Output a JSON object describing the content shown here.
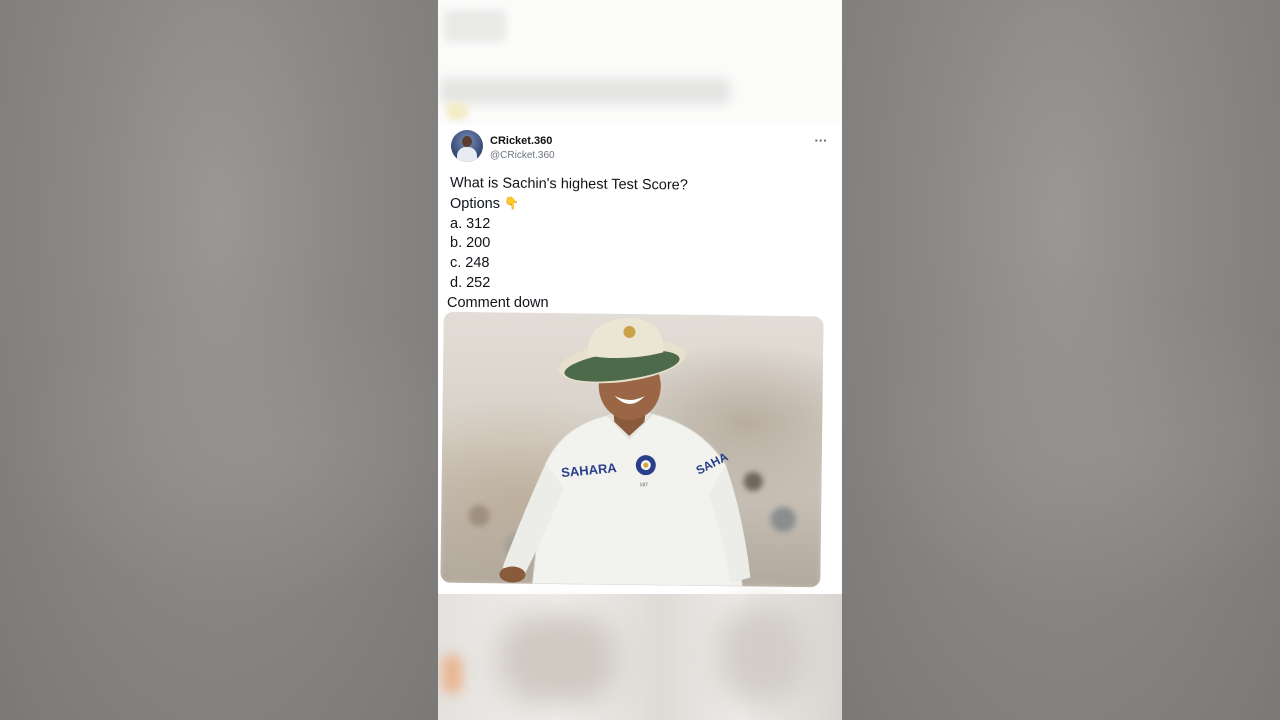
{
  "tweet": {
    "display_name": "CRicket.360",
    "handle": "@CRicket.360",
    "more_icon": "more-options-icon",
    "more_glyph": "···",
    "lines": {
      "question": "What is Sachin's highest Test Score?",
      "options_label": "Options",
      "option_a": "a. 312",
      "option_b": "b. 200",
      "option_c": "c. 248",
      "option_d": "d. 252",
      "cta": "Comment down"
    },
    "emoji_icon": "pointing-down-hand-icon",
    "emoji_glyph": "👇",
    "photo": {
      "jersey_sponsor_front": "SAHARA",
      "jersey_sponsor_sleeve": "SAHA",
      "jersey_number": "187"
    }
  },
  "colors": {
    "background_outer": "#8c8b89",
    "card": "#ffffff",
    "text_primary": "#0f1419",
    "text_secondary": "#6e767d",
    "hat": "#e7e0cc",
    "hat_brim_under": "#4d6a4a",
    "jersey": "#f2f2ef",
    "badge": "#2a3f8a"
  }
}
